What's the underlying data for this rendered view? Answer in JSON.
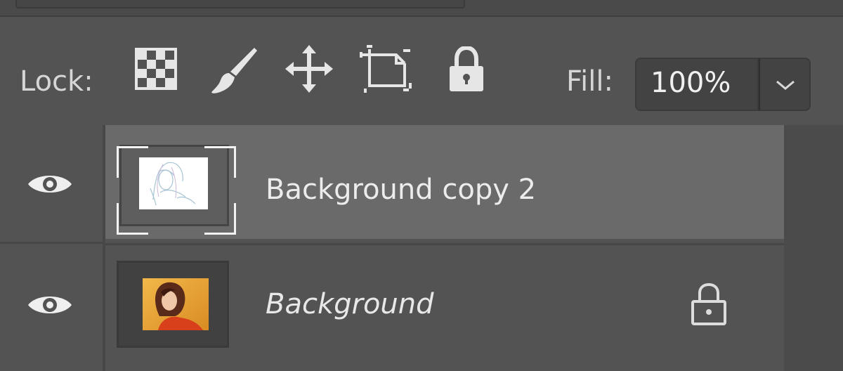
{
  "lock_panel": {
    "label": "Lock:",
    "icons": [
      "lock-transparent-pixels-icon",
      "lock-image-pixels-icon",
      "lock-position-icon",
      "lock-artboard-icon",
      "lock-all-icon"
    ]
  },
  "fill": {
    "label": "Fill:",
    "value": "100%"
  },
  "layers": [
    {
      "name": "Background copy 2",
      "visible": true,
      "selected": true,
      "locked": false
    },
    {
      "name": "Background",
      "visible": true,
      "selected": false,
      "locked": true
    }
  ],
  "colors": {
    "panel_bg": "#535353",
    "selected_row": "#6a6a6a",
    "text": "#e4e4e4"
  }
}
